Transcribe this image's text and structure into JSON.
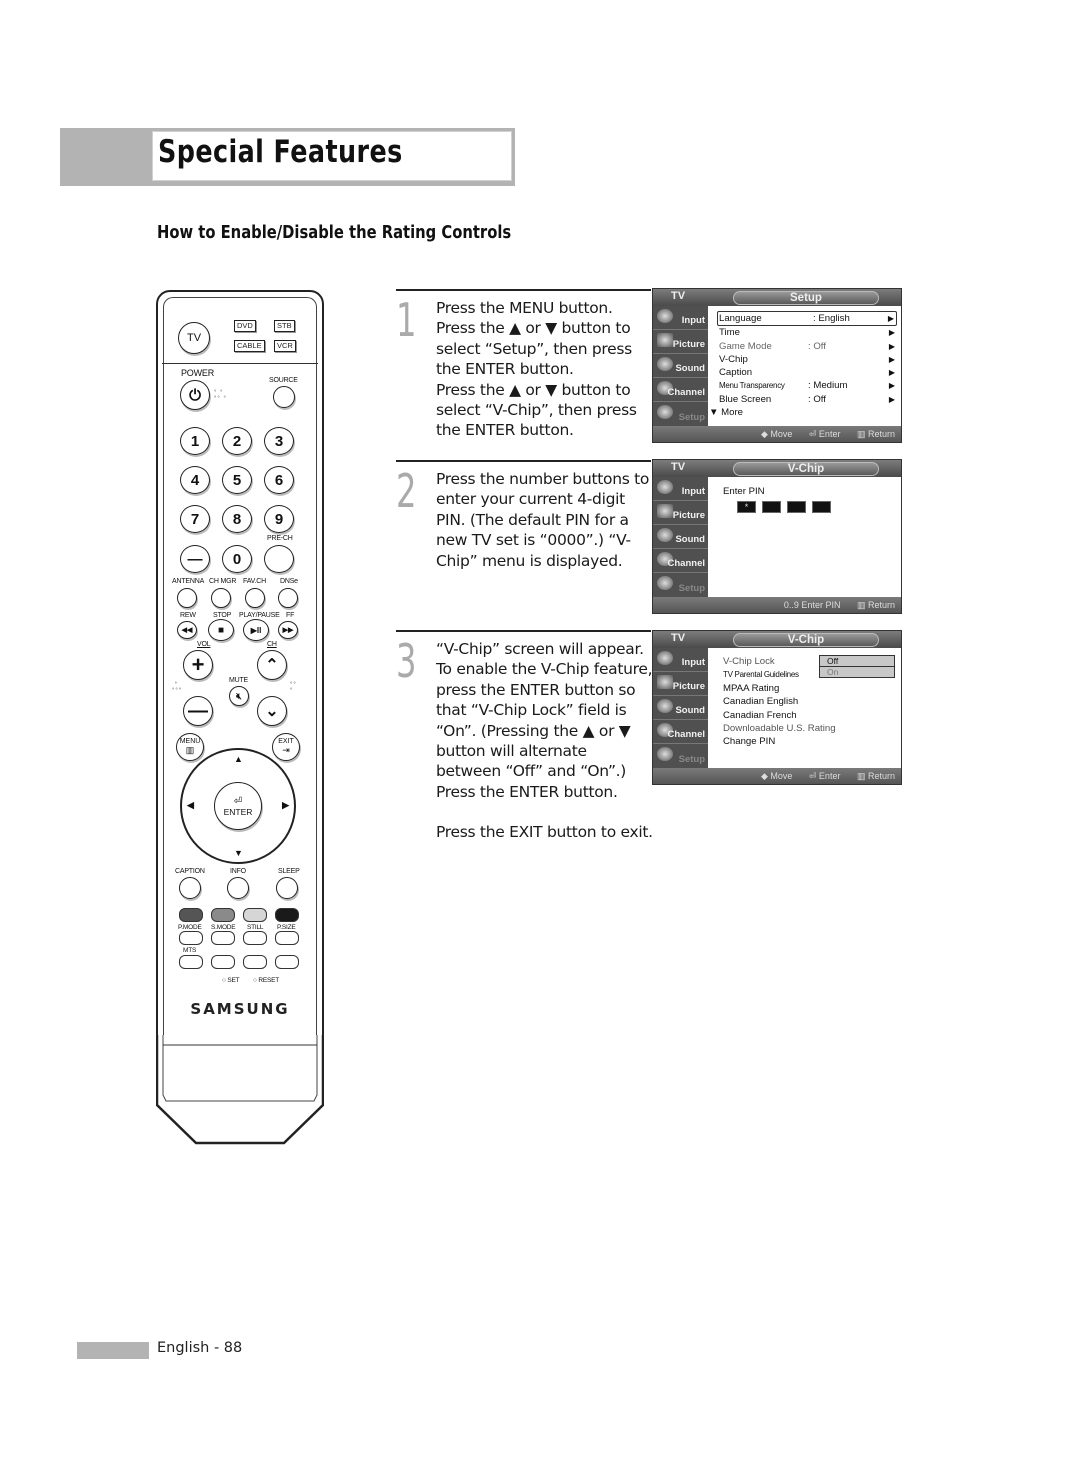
{
  "page": {
    "title": "Special Features",
    "section_heading": "How to Enable/Disable the Rating Controls",
    "footer": "English - 88"
  },
  "remote": {
    "source_buttons": [
      "TV",
      "DVD",
      "STB",
      "CABLE",
      "VCR"
    ],
    "power_label": "POWER",
    "source_label": "SOURCE",
    "number_keys": [
      "1",
      "2",
      "3",
      "4",
      "5",
      "6",
      "7",
      "8",
      "9",
      "—",
      "0",
      ""
    ],
    "pre_ch_label": "PRE-CH",
    "function_labels": [
      "ANTENNA",
      "CH MGR",
      "FAV.CH",
      "DNSe"
    ],
    "transport_labels": [
      "REW",
      "STOP",
      "PLAY/PAUSE",
      "FF"
    ],
    "transport_glyphs": [
      "◀◀",
      "■",
      "▶II",
      "▶▶"
    ],
    "vol_label": "VOL",
    "ch_label": "CH",
    "mute_label": "MUTE",
    "menu_label": "MENU",
    "exit_label": "EXIT",
    "enter_label": "ENTER",
    "bottom_labels": [
      "CAPTION",
      "INFO",
      "SLEEP"
    ],
    "color_key_colors": [
      "#555555",
      "#8a8a8a",
      "#d6d6d6",
      "#1a1a1a"
    ],
    "mode_labels": [
      "P.MODE",
      "S.MODE",
      "STILL",
      "P.SIZE"
    ],
    "mts_label": "MTS",
    "set_label": "SET",
    "reset_label": "RESET",
    "brand": "SAMSUNG"
  },
  "steps": [
    {
      "number": "1",
      "paragraphs": [
        "Press the MENU button.",
        "Press the ▲ or ▼ button to select “Setup”, then press the ENTER button.",
        "Press the ▲ or ▼ button to select “V-Chip”, then press the ENTER button."
      ]
    },
    {
      "number": "2",
      "paragraphs": [
        "Press the number buttons to enter your current 4-digit PIN. (The default PIN for a new TV set is “0000”.) “V-Chip” menu is displayed."
      ]
    },
    {
      "number": "3",
      "paragraphs": [
        "“V-Chip” screen will appear. To enable the V-Chip feature, press the ENTER button so that “V-Chip Lock” field is “On”. (Pressing the ▲ or ▼ button will alternate between “Off” and “On”.)",
        "Press the ENTER button."
      ],
      "after_gap": "Press the EXIT button to exit."
    }
  ],
  "osd": {
    "tv_label": "TV",
    "sidebar": [
      "Input",
      "Picture",
      "Sound",
      "Channel",
      "Setup"
    ],
    "setup_screen": {
      "title": "Setup",
      "rows": [
        {
          "label": "Language",
          "value": ": English",
          "arrow": "▶",
          "selected": true
        },
        {
          "label": "Time",
          "value": "",
          "arrow": "▶"
        },
        {
          "label": "Game Mode",
          "value": ": Off",
          "arrow": "▶",
          "grey": true
        },
        {
          "label": "V-Chip",
          "value": "",
          "arrow": "▶"
        },
        {
          "label": "Caption",
          "value": "",
          "arrow": "▶"
        },
        {
          "label": "Menu Transparency",
          "value": ": Medium",
          "arrow": "▶"
        },
        {
          "label": "Blue Screen",
          "value": ": Off",
          "arrow": "▶"
        },
        {
          "label": "▼ More",
          "value": "",
          "arrow": ""
        }
      ],
      "hints": [
        "◆ Move",
        "⏎ Enter",
        "▥ Return"
      ]
    },
    "pin_screen": {
      "title": "V-Chip",
      "label": "Enter PIN",
      "pin_boxes": [
        "*",
        "",
        "",
        ""
      ],
      "hints": [
        "0..9 Enter PIN",
        "▥ Return"
      ]
    },
    "vchip_screen": {
      "title": "V-Chip",
      "items": [
        "V-Chip Lock",
        "TV Parental Guidelines",
        "MPAA Rating",
        "Canadian English",
        "Canadian French",
        "Downloadable U.S. Rating",
        "Change PIN"
      ],
      "dropdown": {
        "selected": "Off",
        "other": "On"
      },
      "hints": [
        "◆ Move",
        "⏎ Enter",
        "▥ Return"
      ]
    }
  }
}
